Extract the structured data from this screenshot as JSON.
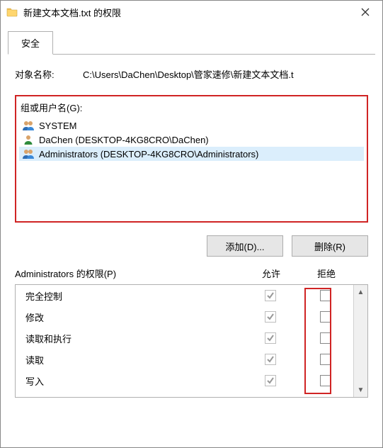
{
  "window": {
    "title": "新建文本文档.txt 的权限"
  },
  "tabs": {
    "security": "安全"
  },
  "object": {
    "label": "对象名称:",
    "path": "C:\\Users\\DaChen\\Desktop\\管家速修\\新建文本文档.t"
  },
  "groups": {
    "label": "组或用户名(G):",
    "items": [
      {
        "name": "SYSTEM",
        "type": "group"
      },
      {
        "name": "DaChen (DESKTOP-4KG8CRO\\DaChen)",
        "type": "user"
      },
      {
        "name": "Administrators (DESKTOP-4KG8CRO\\Administrators)",
        "type": "group"
      }
    ]
  },
  "buttons": {
    "add": "添加(D)...",
    "remove": "删除(R)"
  },
  "perm_header": {
    "title": "Administrators 的权限(P)",
    "allow": "允许",
    "deny": "拒绝"
  },
  "permissions": [
    {
      "name": "完全控制",
      "allow": true,
      "deny": false
    },
    {
      "name": "修改",
      "allow": true,
      "deny": false
    },
    {
      "name": "读取和执行",
      "allow": true,
      "deny": false
    },
    {
      "name": "读取",
      "allow": true,
      "deny": false
    },
    {
      "name": "写入",
      "allow": true,
      "deny": false
    }
  ]
}
